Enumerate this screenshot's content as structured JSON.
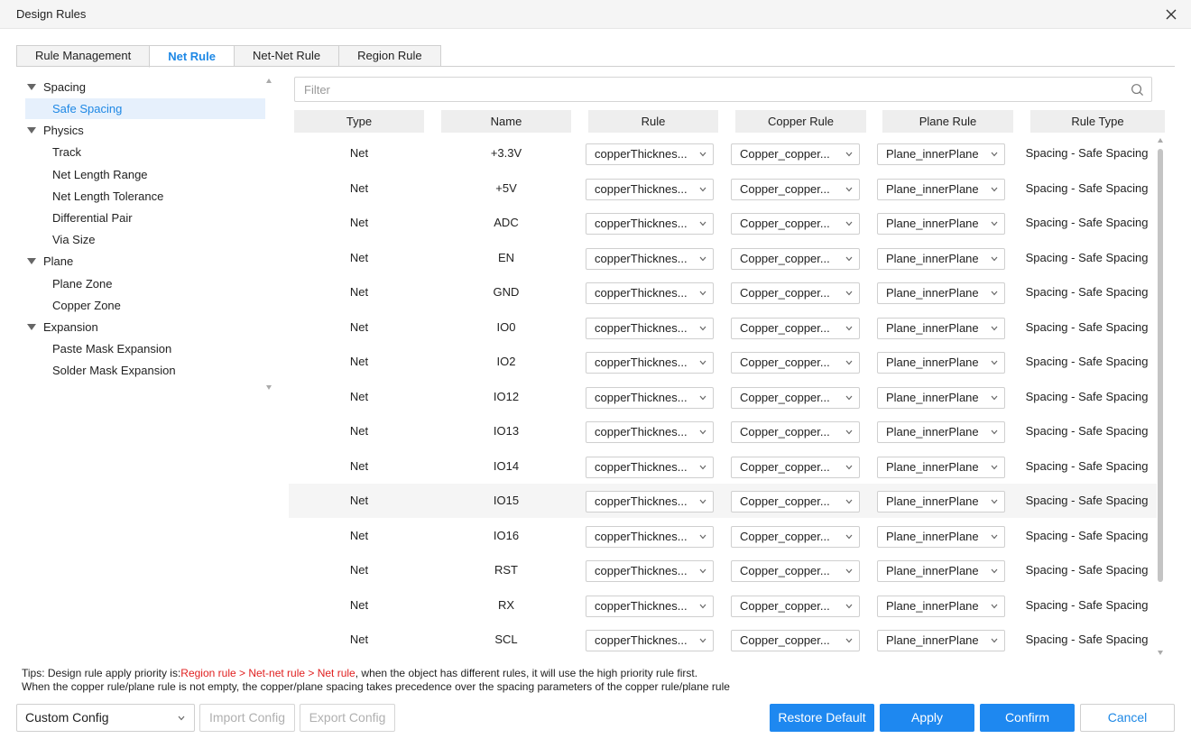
{
  "window": {
    "title": "Design Rules"
  },
  "tabs": [
    "Rule Management",
    "Net Rule",
    "Net-Net Rule",
    "Region Rule"
  ],
  "active_tab": "Net Rule",
  "tree": {
    "spacing": "Spacing",
    "safe_spacing": "Safe Spacing",
    "physics": "Physics",
    "track": "Track",
    "net_length_range": "Net Length Range",
    "net_length_tolerance": "Net Length Tolerance",
    "differential_pair": "Differential Pair",
    "via_size": "Via Size",
    "plane": "Plane",
    "plane_zone": "Plane Zone",
    "copper_zone": "Copper Zone",
    "expansion": "Expansion",
    "paste_mask_expansion": "Paste Mask Expansion",
    "solder_mask_expansion": "Solder Mask Expansion"
  },
  "filter": {
    "placeholder": "Filter"
  },
  "table": {
    "columns": [
      "Type",
      "Name",
      "Rule",
      "Copper Rule",
      "Plane Rule",
      "Rule Type"
    ],
    "rows": [
      {
        "type": "Net",
        "name": "+3.3V",
        "rule": "copperThicknes...",
        "copper_rule": "Copper_copper...",
        "plane_rule": "Plane_innerPlane",
        "rule_type": "Spacing - Safe Spacing"
      },
      {
        "type": "Net",
        "name": "+5V",
        "rule": "copperThicknes...",
        "copper_rule": "Copper_copper...",
        "plane_rule": "Plane_innerPlane",
        "rule_type": "Spacing - Safe Spacing"
      },
      {
        "type": "Net",
        "name": "ADC",
        "rule": "copperThicknes...",
        "copper_rule": "Copper_copper...",
        "plane_rule": "Plane_innerPlane",
        "rule_type": "Spacing - Safe Spacing"
      },
      {
        "type": "Net",
        "name": "EN",
        "rule": "copperThicknes...",
        "copper_rule": "Copper_copper...",
        "plane_rule": "Plane_innerPlane",
        "rule_type": "Spacing - Safe Spacing"
      },
      {
        "type": "Net",
        "name": "GND",
        "rule": "copperThicknes...",
        "copper_rule": "Copper_copper...",
        "plane_rule": "Plane_innerPlane",
        "rule_type": "Spacing - Safe Spacing"
      },
      {
        "type": "Net",
        "name": "IO0",
        "rule": "copperThicknes...",
        "copper_rule": "Copper_copper...",
        "plane_rule": "Plane_innerPlane",
        "rule_type": "Spacing - Safe Spacing"
      },
      {
        "type": "Net",
        "name": "IO2",
        "rule": "copperThicknes...",
        "copper_rule": "Copper_copper...",
        "plane_rule": "Plane_innerPlane",
        "rule_type": "Spacing - Safe Spacing"
      },
      {
        "type": "Net",
        "name": "IO12",
        "rule": "copperThicknes...",
        "copper_rule": "Copper_copper...",
        "plane_rule": "Plane_innerPlane",
        "rule_type": "Spacing - Safe Spacing"
      },
      {
        "type": "Net",
        "name": "IO13",
        "rule": "copperThicknes...",
        "copper_rule": "Copper_copper...",
        "plane_rule": "Plane_innerPlane",
        "rule_type": "Spacing - Safe Spacing"
      },
      {
        "type": "Net",
        "name": "IO14",
        "rule": "copperThicknes...",
        "copper_rule": "Copper_copper...",
        "plane_rule": "Plane_innerPlane",
        "rule_type": "Spacing - Safe Spacing"
      },
      {
        "type": "Net",
        "name": "IO15",
        "rule": "copperThicknes...",
        "copper_rule": "Copper_copper...",
        "plane_rule": "Plane_innerPlane",
        "rule_type": "Spacing - Safe Spacing"
      },
      {
        "type": "Net",
        "name": "IO16",
        "rule": "copperThicknes...",
        "copper_rule": "Copper_copper...",
        "plane_rule": "Plane_innerPlane",
        "rule_type": "Spacing - Safe Spacing"
      },
      {
        "type": "Net",
        "name": "RST",
        "rule": "copperThicknes...",
        "copper_rule": "Copper_copper...",
        "plane_rule": "Plane_innerPlane",
        "rule_type": "Spacing - Safe Spacing"
      },
      {
        "type": "Net",
        "name": "RX",
        "rule": "copperThicknes...",
        "copper_rule": "Copper_copper...",
        "plane_rule": "Plane_innerPlane",
        "rule_type": "Spacing - Safe Spacing"
      },
      {
        "type": "Net",
        "name": "SCL",
        "rule": "copperThicknes...",
        "copper_rule": "Copper_copper...",
        "plane_rule": "Plane_innerPlane",
        "rule_type": "Spacing - Safe Spacing"
      }
    ]
  },
  "tips": {
    "line1_prefix": "Tips: Design rule apply priority is:",
    "line1_priority": "Region rule > Net-net rule > Net rule",
    "line1_suffix": ", when the object has different rules, it will use the high priority rule first.",
    "line2": "When the copper rule/plane rule is not empty, the copper/plane spacing takes precedence over the spacing parameters of the copper rule/plane rule"
  },
  "footer": {
    "config_value": "Custom Config",
    "import_config": "Import Config",
    "export_config": "Export Config",
    "restore_default": "Restore Default",
    "apply": "Apply",
    "confirm": "Confirm",
    "cancel": "Cancel"
  },
  "colors": {
    "accent": "#1e88f0",
    "priority_text": "#e02020",
    "selected_bg": "#e6f0fc"
  },
  "icons": {
    "close": "close-icon",
    "search": "search-icon",
    "dropdown": "chevron-down-icon",
    "tree_toggle": "caret-down-icon"
  }
}
